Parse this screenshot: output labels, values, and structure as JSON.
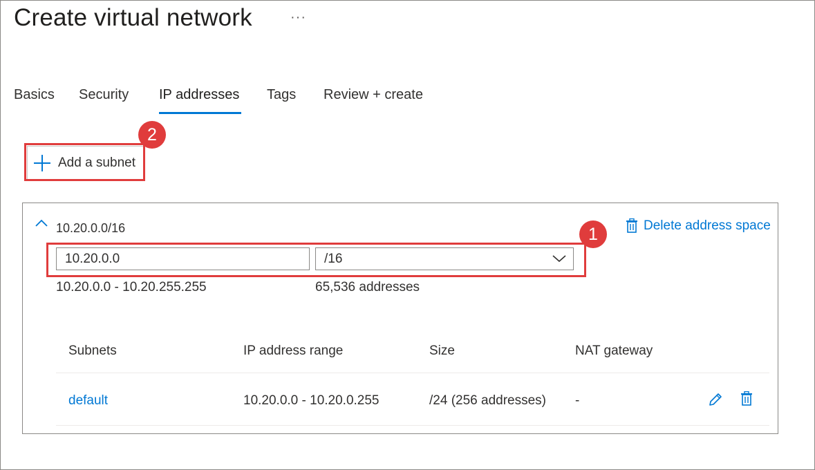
{
  "page": {
    "title": "Create virtual network",
    "more_label": "···"
  },
  "tabs": [
    {
      "label": "Basics",
      "active": false
    },
    {
      "label": "Security",
      "active": false
    },
    {
      "label": "IP addresses",
      "active": true
    },
    {
      "label": "Tags",
      "active": false
    },
    {
      "label": "Review + create",
      "active": false
    }
  ],
  "toolbar": {
    "add_subnet_label": "Add a subnet",
    "add_icon": "plus-icon"
  },
  "annotations": {
    "badge_1": "1",
    "badge_2": "2",
    "highlight_color": "#e03c3c"
  },
  "address_space": {
    "title": "10.20.0.0/16",
    "collapse_icon": "chevron-up-icon",
    "delete_label": "Delete address space",
    "delete_icon": "trash-icon",
    "start_ip": "10.20.0.0",
    "prefix": "/16",
    "range": "10.20.0.0 - 10.20.255.255",
    "count": "65,536 addresses"
  },
  "subnets_table": {
    "headers": [
      "Subnets",
      "IP address range",
      "Size",
      "NAT gateway"
    ],
    "rows": [
      {
        "name": "default",
        "range": "10.20.0.0 - 10.20.0.255",
        "size": "/24 (256 addresses)",
        "nat": "-"
      }
    ]
  },
  "colors": {
    "accent": "#0078d4",
    "text": "#323130",
    "border": "#8a8886"
  }
}
